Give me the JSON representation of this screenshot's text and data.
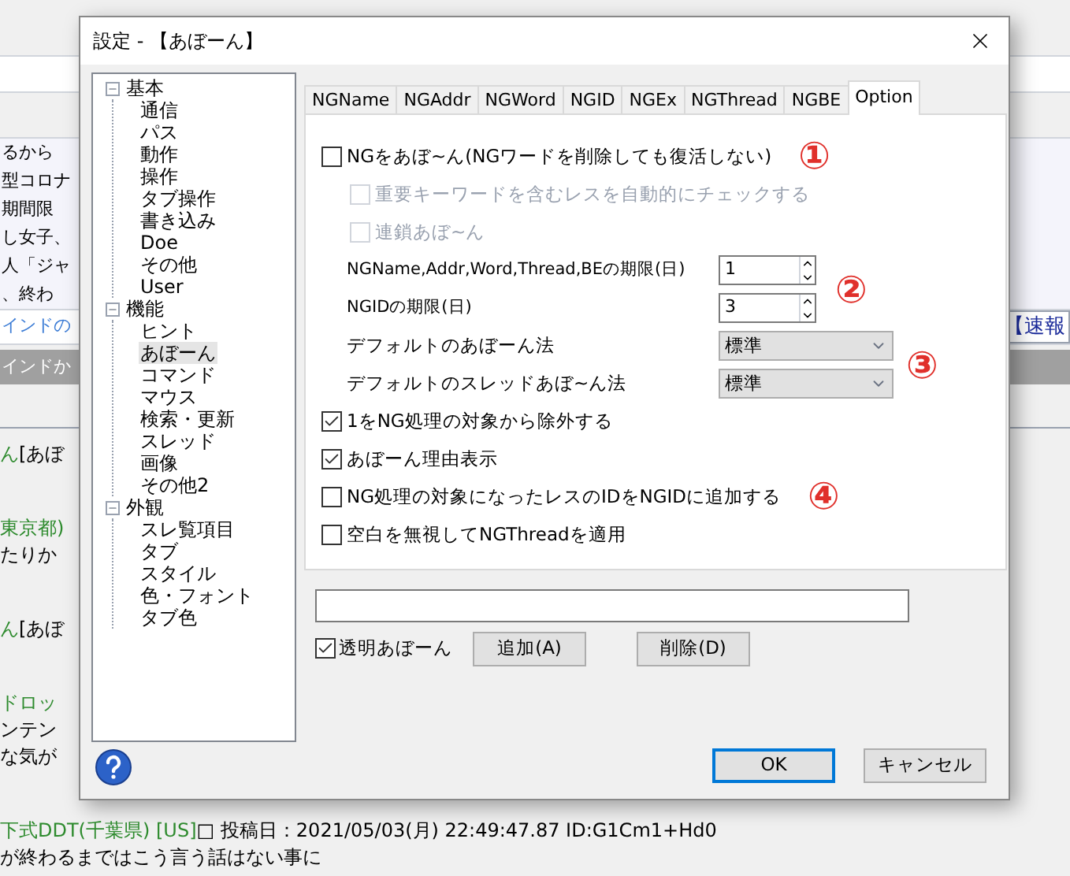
{
  "background": {
    "list_rows": [
      "るから",
      "型コロナ",
      "期間限",
      "し女子、",
      "人「ジャ",
      "、終わ"
    ],
    "link_row": "インドの",
    "selected_row": "インドか",
    "ticker": "【速報",
    "posts": [
      [
        [
          {
            "text": "ん",
            "kind": "green"
          },
          {
            "text": "[あぼ",
            "kind": "plain"
          }
        ]
      ],
      [
        [
          {
            "text": "東京都)",
            "kind": "green"
          }
        ],
        [
          {
            "text": "たりか",
            "kind": "plain"
          }
        ]
      ],
      [
        [
          {
            "text": "ん",
            "kind": "green"
          },
          {
            "text": "[あぼ",
            "kind": "plain"
          }
        ]
      ],
      [
        [
          {
            "text": "ドロッ",
            "kind": "green"
          }
        ],
        [
          {
            "text": "ンテン",
            "kind": "plain"
          }
        ],
        [
          {
            "text": "な気が",
            "kind": "plain"
          }
        ]
      ],
      [
        [
          {
            "text": "下式DDT(千葉県) [US]",
            "kind": "green"
          },
          {
            "text": "□ 投稿日：2021/05/03(月) 22:49:47.87 ID:G1Cm1+Hd0",
            "kind": "plain"
          }
        ],
        [
          {
            "text": "が終わるまではこう言う話はない事に",
            "kind": "plain"
          }
        ]
      ]
    ]
  },
  "dialog": {
    "title": "設定 - 【あぼーん】",
    "tree": [
      {
        "label": "基本",
        "expanded": true,
        "children": [
          {
            "label": "通信",
            "selected": false
          },
          {
            "label": "パス",
            "selected": false
          },
          {
            "label": "動作",
            "selected": false
          },
          {
            "label": "操作",
            "selected": false
          },
          {
            "label": "タブ操作",
            "selected": false
          },
          {
            "label": "書き込み",
            "selected": false
          },
          {
            "label": "Doe",
            "selected": false
          },
          {
            "label": "その他",
            "selected": false
          },
          {
            "label": "User",
            "selected": false
          }
        ]
      },
      {
        "label": "機能",
        "expanded": true,
        "children": [
          {
            "label": "ヒント",
            "selected": false
          },
          {
            "label": "あぼーん",
            "selected": true
          },
          {
            "label": "コマンド",
            "selected": false
          },
          {
            "label": "マウス",
            "selected": false
          },
          {
            "label": "検索・更新",
            "selected": false
          },
          {
            "label": "スレッド",
            "selected": false
          },
          {
            "label": "画像",
            "selected": false
          },
          {
            "label": "その他2",
            "selected": false
          }
        ]
      },
      {
        "label": "外観",
        "expanded": true,
        "children": [
          {
            "label": "スレ覧項目",
            "selected": false
          },
          {
            "label": "タブ",
            "selected": false
          },
          {
            "label": "スタイル",
            "selected": false
          },
          {
            "label": "色・フォント",
            "selected": false
          },
          {
            "label": "タブ色",
            "selected": false
          }
        ]
      }
    ],
    "tabs": [
      {
        "label": "NGName",
        "selected": false
      },
      {
        "label": "NGAddr",
        "selected": false
      },
      {
        "label": "NGWord",
        "selected": false
      },
      {
        "label": "NGID",
        "selected": false
      },
      {
        "label": "NGEx",
        "selected": false
      },
      {
        "label": "NGThread",
        "selected": false
      },
      {
        "label": "NGBE",
        "selected": false
      },
      {
        "label": "Option",
        "selected": true
      }
    ],
    "options": [
      {
        "kind": "checkbox",
        "label": "NGをあぼ~ん(NGワードを削除しても復活しない)",
        "checked": false,
        "disabled": false,
        "indent": false,
        "marker": "①"
      },
      {
        "kind": "checkbox",
        "label": "重要キーワードを含むレスを自動的にチェックする",
        "checked": false,
        "disabled": true,
        "indent": true
      },
      {
        "kind": "checkbox",
        "label": "連鎖あぼ~ん",
        "checked": false,
        "disabled": true,
        "indent": true
      },
      {
        "kind": "spin",
        "label": "NGName,Addr,Word,Thread,BEの期限(日)",
        "value": "1",
        "marker": "②"
      },
      {
        "kind": "spin",
        "label": "NGIDの期限(日)",
        "value": "3"
      },
      {
        "kind": "select",
        "label": "デフォルトのあぼーん法",
        "value": "標準",
        "marker": "③"
      },
      {
        "kind": "select",
        "label": "デフォルトのスレッドあぼ~ん法",
        "value": "標準"
      },
      {
        "kind": "checkbox",
        "label": "1をNG処理の対象から除外する",
        "checked": true,
        "disabled": false,
        "indent": false
      },
      {
        "kind": "checkbox",
        "label": "あぼーん理由表示",
        "checked": true,
        "disabled": false,
        "indent": false
      },
      {
        "kind": "checkbox",
        "label": "NG処理の対象になったレスのIDをNGIDに追加する",
        "checked": false,
        "disabled": false,
        "indent": false,
        "marker": "④"
      },
      {
        "kind": "checkbox",
        "label": "空白を無視してNGThreadを適用",
        "checked": false,
        "disabled": false,
        "indent": false
      }
    ],
    "transparent": {
      "label": "透明あぼーん",
      "checked": true
    },
    "add_button": "追加(A)",
    "delete_button": "削除(D)",
    "ok_button": "OK",
    "cancel_button": "キャンセル"
  }
}
